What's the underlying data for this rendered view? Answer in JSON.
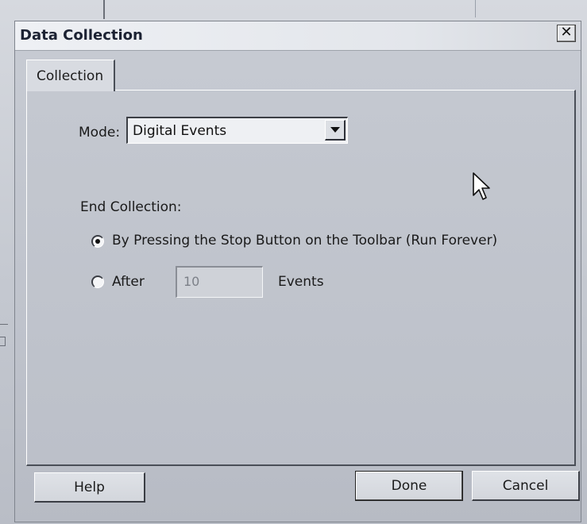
{
  "dialog": {
    "title": "Data Collection",
    "close_glyph": "✕"
  },
  "tabs": [
    {
      "label": "Collection",
      "active": true
    }
  ],
  "mode": {
    "label": "Mode:",
    "value": "Digital Events"
  },
  "end_collection": {
    "label": "End Collection:",
    "options": [
      {
        "label": "By Pressing the Stop Button on the Toolbar (Run Forever)",
        "checked": true
      },
      {
        "label": "After",
        "checked": false
      }
    ],
    "after_value": "10",
    "after_units": "Events"
  },
  "buttons": {
    "help": "Help",
    "done": "Done",
    "cancel": "Cancel"
  },
  "icons": {
    "close": "close-icon",
    "dropdown": "chevron-down-icon",
    "radio": "radio-icon",
    "cursor": "mouse-pointer-icon"
  },
  "colors": {
    "dialog_bg": "#c4c8d0",
    "title_text": "#1c2233"
  }
}
